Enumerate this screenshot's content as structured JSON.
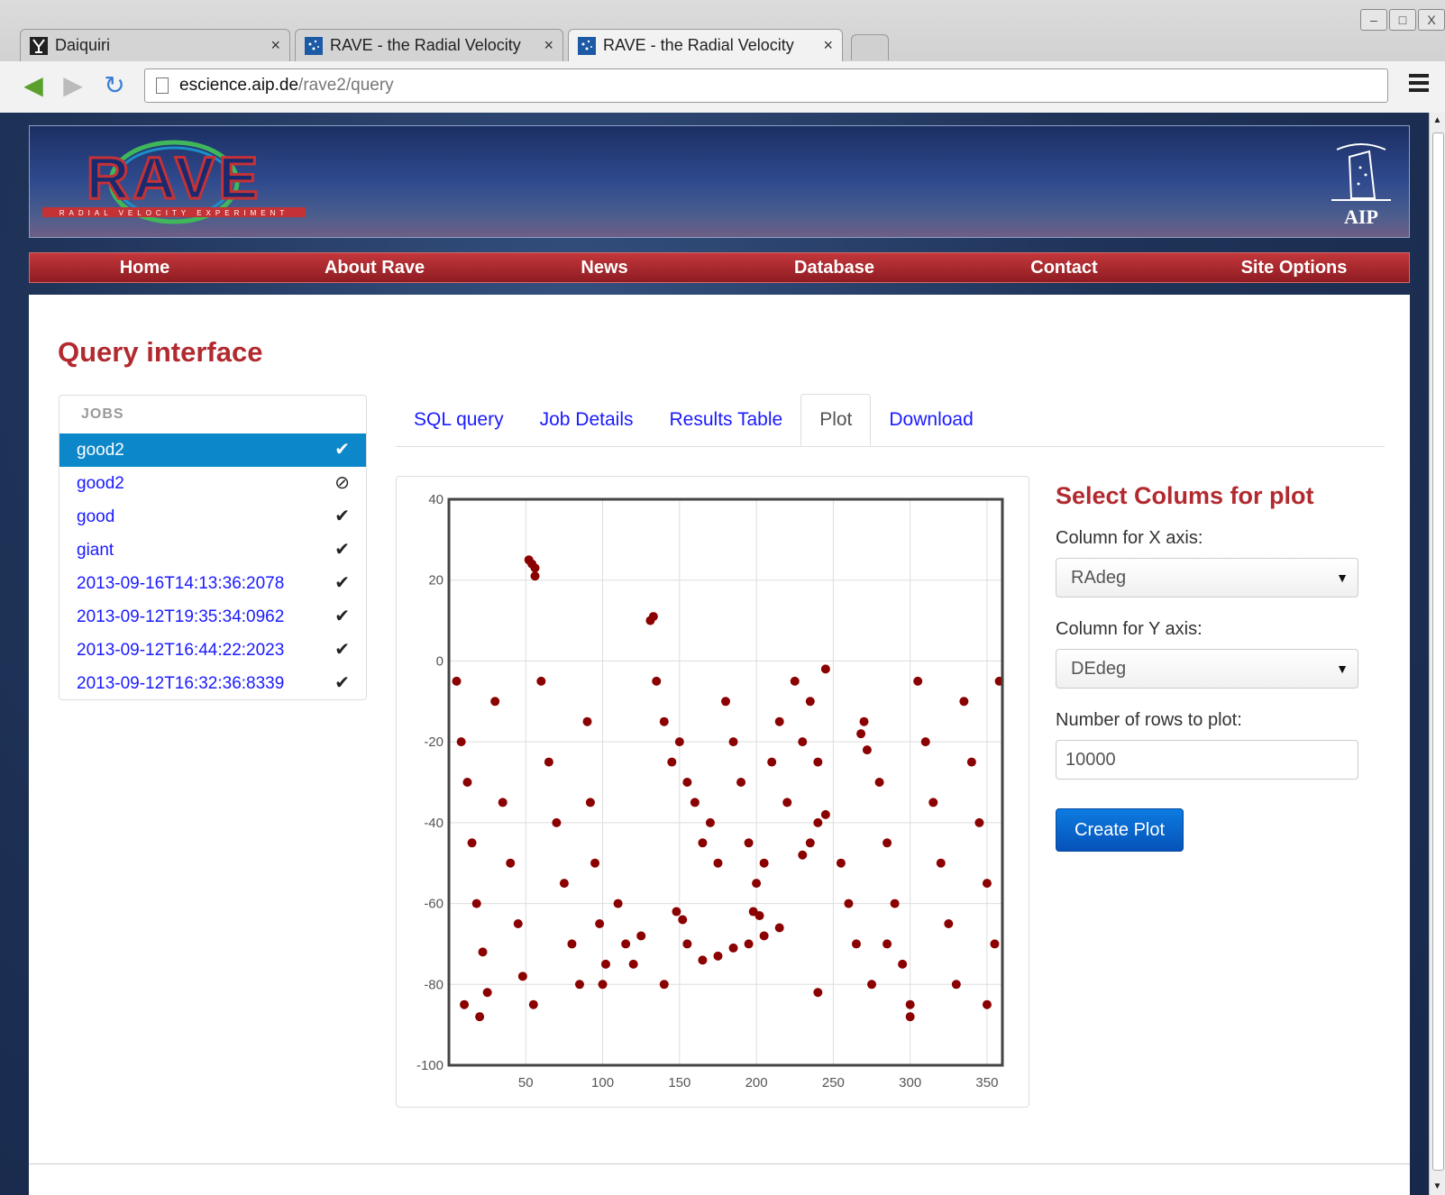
{
  "browser": {
    "tabs": [
      {
        "title": "Daiquiri",
        "close": "×",
        "active": false
      },
      {
        "title": "RAVE - the Radial Velocity",
        "close": "×",
        "active": false
      },
      {
        "title": "RAVE - the Radial Velocity",
        "close": "×",
        "active": true
      }
    ],
    "url_host": "escience.aip.de",
    "url_path": "/rave2/query",
    "window_buttons": [
      "–",
      "□",
      "X"
    ]
  },
  "site": {
    "logo_text": "RAVE",
    "logo_subtitle": "RADIAL VELOCITY EXPERIMENT",
    "aip_label": "AIP",
    "nav": [
      "Home",
      "About Rave",
      "News",
      "Database",
      "Contact",
      "Site Options"
    ],
    "colors": {
      "accent": "#b22a2f",
      "link": "#1a1aff",
      "active_job": "#0c87c9",
      "point": "#8b0000"
    }
  },
  "page": {
    "title": "Query interface",
    "jobs_header": "JOBS",
    "jobs": [
      {
        "name": "good2",
        "status": "✔",
        "status_name": "check-icon",
        "active": true
      },
      {
        "name": "good2",
        "status": "⊘",
        "status_name": "cancelled-icon",
        "active": false
      },
      {
        "name": "good",
        "status": "✔",
        "status_name": "check-icon",
        "active": false
      },
      {
        "name": "giant",
        "status": "✔",
        "status_name": "check-icon",
        "active": false
      },
      {
        "name": "2013-09-16T14:13:36:2078",
        "status": "✔",
        "status_name": "check-icon",
        "active": false
      },
      {
        "name": "2013-09-12T19:35:34:0962",
        "status": "✔",
        "status_name": "check-icon",
        "active": false
      },
      {
        "name": "2013-09-12T16:44:22:2023",
        "status": "✔",
        "status_name": "check-icon",
        "active": false
      },
      {
        "name": "2013-09-12T16:32:36:8339",
        "status": "✔",
        "status_name": "check-icon",
        "active": false
      }
    ],
    "tabs": [
      "SQL query",
      "Job Details",
      "Results Table",
      "Plot",
      "Download"
    ],
    "active_tab": "Plot"
  },
  "form": {
    "title": "Select Colums for plot",
    "x_label": "Column for X axis:",
    "x_value": "RAdeg",
    "y_label": "Column for Y axis:",
    "y_value": "DEdeg",
    "rows_label": "Number of rows to plot:",
    "rows_value": "10000",
    "button": "Create Plot",
    "caret": "▼"
  },
  "chart_data": {
    "type": "scatter",
    "title": "",
    "xlabel": "",
    "ylabel": "",
    "xlim": [
      0,
      360
    ],
    "ylim": [
      -100,
      40
    ],
    "x_ticks": [
      50,
      100,
      150,
      200,
      250,
      300,
      350
    ],
    "y_ticks": [
      40,
      20,
      0,
      -20,
      -40,
      -60,
      -80,
      -100
    ],
    "grid": true,
    "color": "#8b0000",
    "series": [
      {
        "values": [
          [
            52,
            25
          ],
          [
            54,
            24
          ],
          [
            56,
            23
          ],
          [
            56,
            21
          ],
          [
            131,
            10
          ],
          [
            133,
            11
          ],
          [
            5,
            -5
          ],
          [
            8,
            -20
          ],
          [
            12,
            -30
          ],
          [
            15,
            -45
          ],
          [
            18,
            -60
          ],
          [
            22,
            -72
          ],
          [
            25,
            -82
          ],
          [
            30,
            -10
          ],
          [
            35,
            -35
          ],
          [
            40,
            -50
          ],
          [
            45,
            -65
          ],
          [
            48,
            -78
          ],
          [
            55,
            -85
          ],
          [
            60,
            -5
          ],
          [
            65,
            -25
          ],
          [
            70,
            -40
          ],
          [
            75,
            -55
          ],
          [
            80,
            -70
          ],
          [
            85,
            -80
          ],
          [
            90,
            -15
          ],
          [
            92,
            -35
          ],
          [
            95,
            -50
          ],
          [
            98,
            -65
          ],
          [
            102,
            -75
          ],
          [
            110,
            -60
          ],
          [
            115,
            -70
          ],
          [
            120,
            -75
          ],
          [
            125,
            -68
          ],
          [
            135,
            -5
          ],
          [
            140,
            -15
          ],
          [
            145,
            -25
          ],
          [
            150,
            -20
          ],
          [
            155,
            -30
          ],
          [
            160,
            -35
          ],
          [
            165,
            -45
          ],
          [
            170,
            -40
          ],
          [
            175,
            -50
          ],
          [
            180,
            -10
          ],
          [
            185,
            -20
          ],
          [
            190,
            -30
          ],
          [
            195,
            -45
          ],
          [
            200,
            -55
          ],
          [
            205,
            -50
          ],
          [
            210,
            -25
          ],
          [
            215,
            -15
          ],
          [
            220,
            -35
          ],
          [
            225,
            -5
          ],
          [
            230,
            -20
          ],
          [
            235,
            -10
          ],
          [
            240,
            -25
          ],
          [
            245,
            -2
          ],
          [
            155,
            -70
          ],
          [
            165,
            -74
          ],
          [
            175,
            -73
          ],
          [
            185,
            -71
          ],
          [
            195,
            -70
          ],
          [
            205,
            -68
          ],
          [
            215,
            -66
          ],
          [
            148,
            -62
          ],
          [
            152,
            -64
          ],
          [
            198,
            -62
          ],
          [
            202,
            -63
          ],
          [
            230,
            -48
          ],
          [
            235,
            -45
          ],
          [
            240,
            -40
          ],
          [
            245,
            -38
          ],
          [
            270,
            -15
          ],
          [
            272,
            -22
          ],
          [
            268,
            -18
          ],
          [
            280,
            -30
          ],
          [
            285,
            -45
          ],
          [
            290,
            -60
          ],
          [
            295,
            -75
          ],
          [
            300,
            -85
          ],
          [
            305,
            -5
          ],
          [
            310,
            -20
          ],
          [
            315,
            -35
          ],
          [
            320,
            -50
          ],
          [
            325,
            -65
          ],
          [
            330,
            -80
          ],
          [
            335,
            -10
          ],
          [
            340,
            -25
          ],
          [
            345,
            -40
          ],
          [
            350,
            -55
          ],
          [
            355,
            -70
          ],
          [
            358,
            -5
          ],
          [
            260,
            -60
          ],
          [
            265,
            -70
          ],
          [
            275,
            -80
          ],
          [
            285,
            -70
          ],
          [
            255,
            -50
          ],
          [
            10,
            -85
          ],
          [
            20,
            -88
          ],
          [
            100,
            -80
          ],
          [
            140,
            -80
          ],
          [
            240,
            -82
          ],
          [
            300,
            -88
          ],
          [
            350,
            -85
          ]
        ]
      }
    ]
  }
}
